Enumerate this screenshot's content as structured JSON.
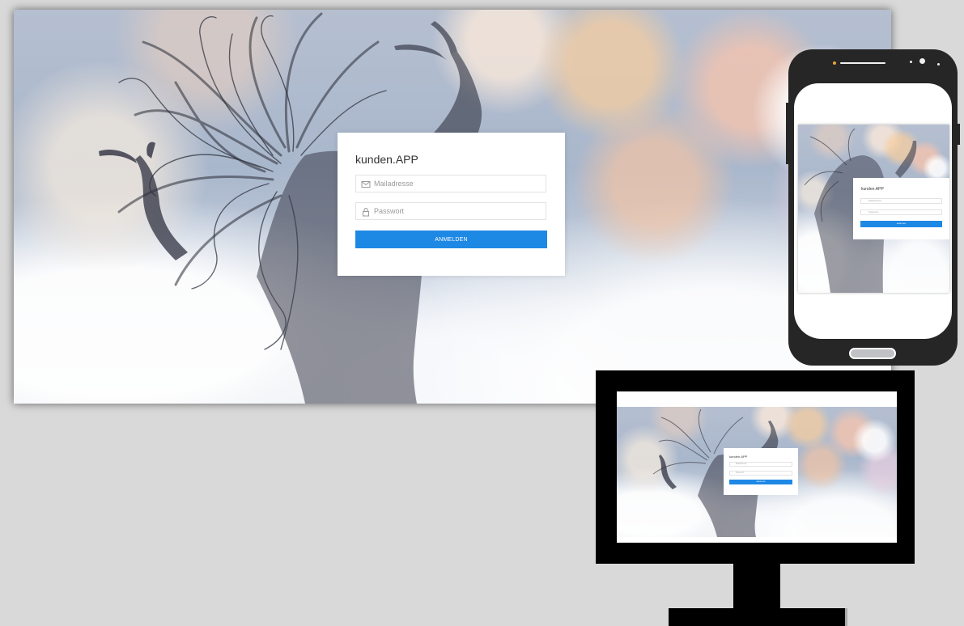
{
  "app": {
    "title": "kunden.APP",
    "email_placeholder": "Mailadresse",
    "password_placeholder": "Passwort",
    "submit_label": "ANMELDEN"
  },
  "icons": {
    "email": "mail-icon",
    "password": "lock-icon"
  },
  "colors": {
    "accent": "#1e88e5",
    "page_background": "#d9d9d9",
    "device_frame": "#262626",
    "monitor_frame": "#000000"
  }
}
